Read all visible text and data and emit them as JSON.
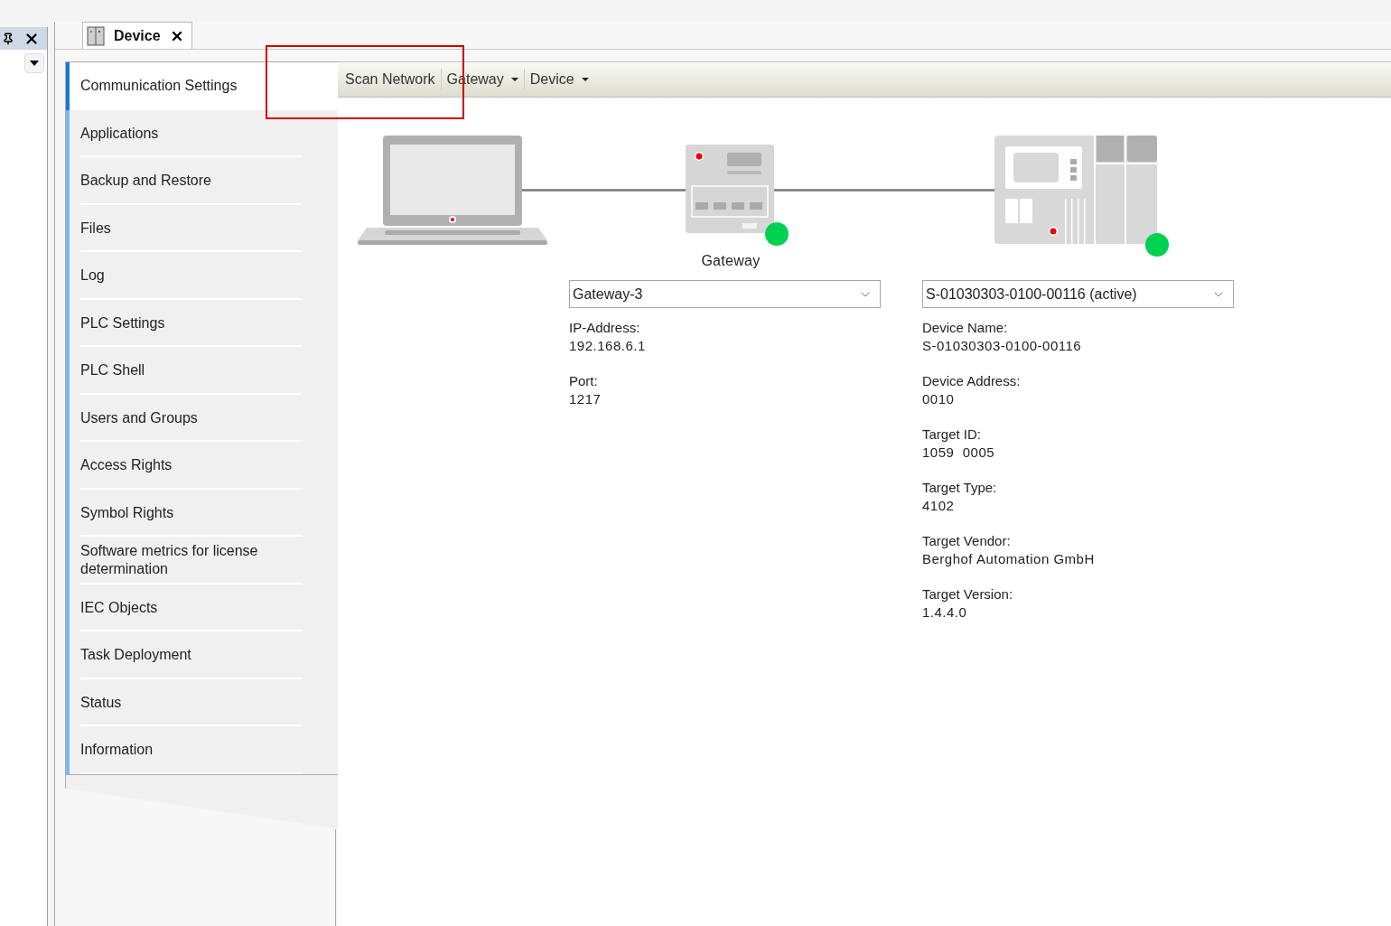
{
  "editor_tab": {
    "label": "Device",
    "selected": true
  },
  "sidebar": {
    "items": [
      {
        "label": "Communication Settings",
        "selected": true
      },
      {
        "label": "Applications",
        "selected": false
      },
      {
        "label": "Backup and Restore",
        "selected": false
      },
      {
        "label": "Files",
        "selected": false
      },
      {
        "label": "Log",
        "selected": false
      },
      {
        "label": "PLC Settings",
        "selected": false
      },
      {
        "label": "PLC Shell",
        "selected": false
      },
      {
        "label": "Users and Groups",
        "selected": false
      },
      {
        "label": "Access Rights",
        "selected": false
      },
      {
        "label": "Symbol Rights",
        "selected": false
      },
      {
        "label": "Software metrics for license determination",
        "selected": false
      },
      {
        "label": "IEC Objects",
        "selected": false
      },
      {
        "label": "Task Deployment",
        "selected": false
      },
      {
        "label": "Status",
        "selected": false
      },
      {
        "label": "Information",
        "selected": false
      }
    ]
  },
  "toolbar": [
    {
      "label": "Scan Network",
      "kind": "button"
    },
    {
      "label": "Gateway",
      "kind": "dropdown"
    },
    {
      "label": "Device",
      "kind": "dropdown"
    }
  ],
  "gateway": {
    "label": "Gateway",
    "online": true,
    "selection": "Gateway-3",
    "fields": [
      {
        "label": "IP-Address:",
        "value": "192.168.6.1"
      },
      {
        "label": "Port:",
        "value": "1217"
      }
    ]
  },
  "device": {
    "online": true,
    "selection": "S-01030303-0100-00116 (active)",
    "fields": [
      {
        "label": "Device Name:",
        "value": "S-01030303-0100-00116"
      },
      {
        "label": "Device Address:",
        "value": "0010"
      },
      {
        "label": "Target ID:",
        "value": "1059  0005"
      },
      {
        "label": "Target Type:",
        "value": "4102"
      },
      {
        "label": "Target Vendor:",
        "value": "Berghof Automation GmbH"
      },
      {
        "label": "Target Version:",
        "value": "1.4.4.0"
      }
    ]
  }
}
